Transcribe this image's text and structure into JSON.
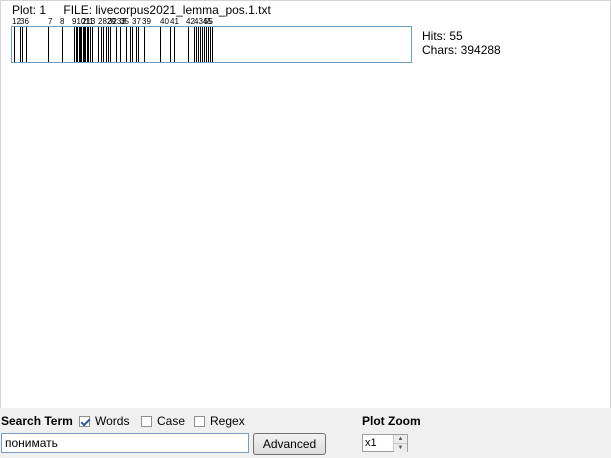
{
  "plot": {
    "plot_label": "Plot: 1",
    "file_label": "FILE: livecorpus2021_lemma_pos.1.txt",
    "hits_label": "Hits: 55",
    "chars_label": "Chars: 394288",
    "total_chars": 394288,
    "hit_positions_fraction": [
      0.005,
      0.02,
      0.025,
      0.035,
      0.09,
      0.125,
      0.155,
      0.16,
      0.163,
      0.167,
      0.17,
      0.173,
      0.177,
      0.18,
      0.183,
      0.187,
      0.19,
      0.195,
      0.2,
      0.215,
      0.222,
      0.228,
      0.235,
      0.24,
      0.245,
      0.26,
      0.27,
      0.285,
      0.295,
      0.3,
      0.31,
      0.315,
      0.33,
      0.37,
      0.395,
      0.405,
      0.44,
      0.455,
      0.46,
      0.465,
      0.47,
      0.475,
      0.48,
      0.485,
      0.49,
      0.495,
      0.5,
      0.49
    ],
    "tick_labels": [
      {
        "text": "12",
        "at": 0.0
      },
      {
        "text": "36",
        "at": 0.02
      },
      {
        "text": "7",
        "at": 0.09
      },
      {
        "text": "8",
        "at": 0.12
      },
      {
        "text": "91011",
        "at": 0.15
      },
      {
        "text": "213",
        "at": 0.175
      },
      {
        "text": "2829",
        "at": 0.215
      },
      {
        "text": "3233",
        "at": 0.24
      },
      {
        "text": "35",
        "at": 0.27
      },
      {
        "text": "37",
        "at": 0.3
      },
      {
        "text": "39",
        "at": 0.325
      },
      {
        "text": "40",
        "at": 0.37
      },
      {
        "text": "41",
        "at": 0.395
      },
      {
        "text": "42",
        "at": 0.435
      },
      {
        "text": "4345",
        "at": 0.455
      },
      {
        "text": "55",
        "at": 0.48
      }
    ]
  },
  "search": {
    "label": "Search Term",
    "value": "понимать",
    "words_label": "Words",
    "words_checked": true,
    "case_label": "Case",
    "case_checked": false,
    "regex_label": "Regex",
    "regex_checked": false,
    "advanced_label": "Advanced"
  },
  "zoom": {
    "label": "Plot Zoom",
    "value": "x1"
  }
}
